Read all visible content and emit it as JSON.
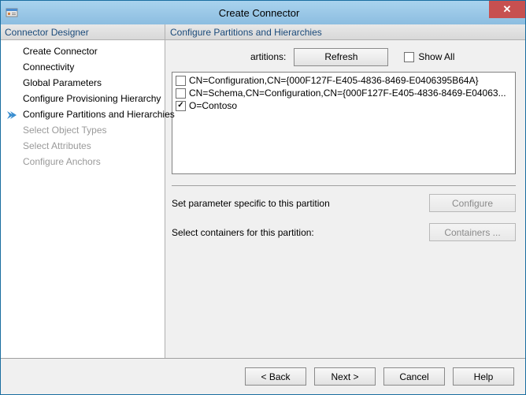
{
  "window": {
    "title": "Create Connector",
    "close_glyph": "✕"
  },
  "sidebar": {
    "header": "Connector Designer",
    "items": [
      {
        "label": "Create Connector",
        "state": "visited"
      },
      {
        "label": "Connectivity",
        "state": "visited"
      },
      {
        "label": "Global Parameters",
        "state": "visited"
      },
      {
        "label": "Configure Provisioning Hierarchy",
        "state": "visited"
      },
      {
        "label": "Configure Partitions and Hierarchies",
        "state": "current"
      },
      {
        "label": "Select Object Types",
        "state": "disabled"
      },
      {
        "label": "Select Attributes",
        "state": "disabled"
      },
      {
        "label": "Configure Anchors",
        "state": "disabled"
      }
    ]
  },
  "content": {
    "header": "Configure Partitions and Hierarchies",
    "partitions_label": "artitions:",
    "refresh_label": "Refresh",
    "show_all_label": "Show All",
    "show_all_checked": false,
    "list": [
      {
        "checked": false,
        "text": "CN=Configuration,CN={000F127F-E405-4836-8469-E0406395B64A}"
      },
      {
        "checked": false,
        "text": "CN=Schema,CN=Configuration,CN={000F127F-E405-4836-8469-E04063..."
      },
      {
        "checked": true,
        "text": "O=Contoso"
      }
    ],
    "param_label": "Set parameter specific to this partition",
    "configure_label": "Configure",
    "containers_label_text": "Select containers for this partition:",
    "containers_button": "Containers ..."
  },
  "footer": {
    "back": "<  Back",
    "next": "Next  >",
    "cancel": "Cancel",
    "help": "Help"
  }
}
